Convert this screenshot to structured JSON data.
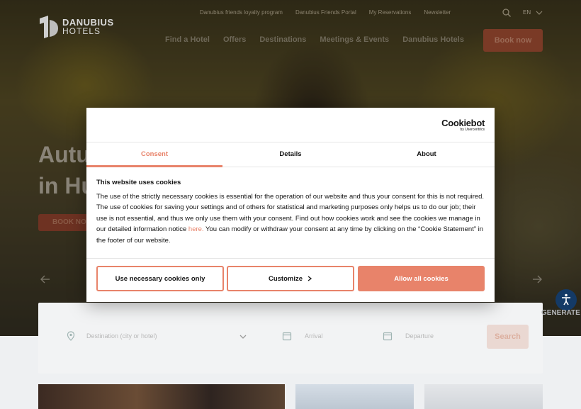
{
  "site": {
    "logo_name": "DANUBIUS",
    "logo_sub": "HOTELS"
  },
  "topbar": {
    "links": [
      "Danubius friends loyalty program",
      "Danubius Friends Portal",
      "My Reservations",
      "Newsletter"
    ],
    "language": "EN"
  },
  "nav": {
    "items": [
      "Find a Hotel",
      "Offers",
      "Destinations",
      "Meetings & Events",
      "Danubius Hotels"
    ],
    "book_now": "Book now"
  },
  "hero": {
    "headline_line1": "Autu",
    "headline_line2": "in Hu",
    "cta": "BOOK NO"
  },
  "booking": {
    "destination_placeholder": "Destination (city or hotel)",
    "arrival_placeholder": "Arrival",
    "departure_placeholder": "Departure",
    "search_label": "Search"
  },
  "widgets": {
    "generate_label": "GENERATE"
  },
  "cookie": {
    "brand": "Cookiebot",
    "brand_sub": "by Usercentrics",
    "tabs": [
      "Consent",
      "Details",
      "About"
    ],
    "heading": "This website uses cookies",
    "body_before_link": "The use of the strictly necessary cookies is essential for the operation of our website and thus your consent for this is not required. The use of cookies for saving your settings and of others for statistical and marketing purposes only helps us to do our job; their use is not essential, and thus we only use them with your consent. Find out how cookies work and see the cookies we manage in our detailed information notice ",
    "link_text": "here.",
    "body_after_link": " You can modify or withdraw your consent at any time by clicking on the “Cookie Statement” in the footer of our website.",
    "btn_necessary": "Use necessary cookies only",
    "btn_customize": "Customize",
    "btn_allow": "Allow all cookies"
  },
  "colors": {
    "accent": "#e8836a",
    "accessibility": "#143a66"
  }
}
